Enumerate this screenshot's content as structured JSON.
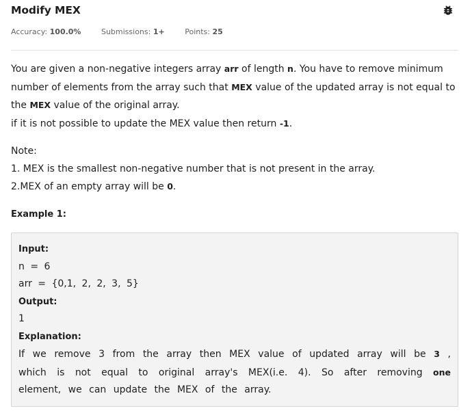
{
  "header": {
    "title": "Modify MEX",
    "bug_icon": "bug-icon"
  },
  "meta": {
    "accuracy_label": "Accuracy:",
    "accuracy_value": "100.0%",
    "submissions_label": "Submissions:",
    "submissions_value": "1+",
    "points_label": "Points:",
    "points_value": "25"
  },
  "problem": {
    "p1_a": "You are given a non-negative integers array ",
    "p1_arr": "arr",
    "p1_b": " of length ",
    "p1_n": "n",
    "p1_c": ". You have to remove minimum number of elements from the array such that ",
    "p1_mex1": "MEX",
    "p1_d": " value of the updated array is not equal to the ",
    "p1_mex2": "MEX",
    "p1_e": " value of the original array.",
    "p2_a": "if it is not possible to update the MEX value then return ",
    "p2_neg": "-1",
    "p2_b": ".",
    "note": "Note:",
    "note1": "1. MEX is the smallest non-negative number that is not present in the array.",
    "note2_a": "2.MEX of an empty array will be ",
    "note2_zero": "0",
    "note2_b": "."
  },
  "example": {
    "title": "Example 1:",
    "input_label": "Input:",
    "input_line1": "n = 6",
    "input_line2": "arr = {0,1, 2, 2, 3, 5}",
    "output_label": "Output:",
    "output_value": "1",
    "explanation_label": "Explanation:",
    "expl_a": "If we remove 3 from the array then MEX value of updated array will be ",
    "expl_3": "3",
    "expl_b": " , which is not equal to original array's MEX(i.e. 4). So after removing ",
    "expl_one": "one",
    "expl_c": " element, we can update the MEX of the array."
  }
}
